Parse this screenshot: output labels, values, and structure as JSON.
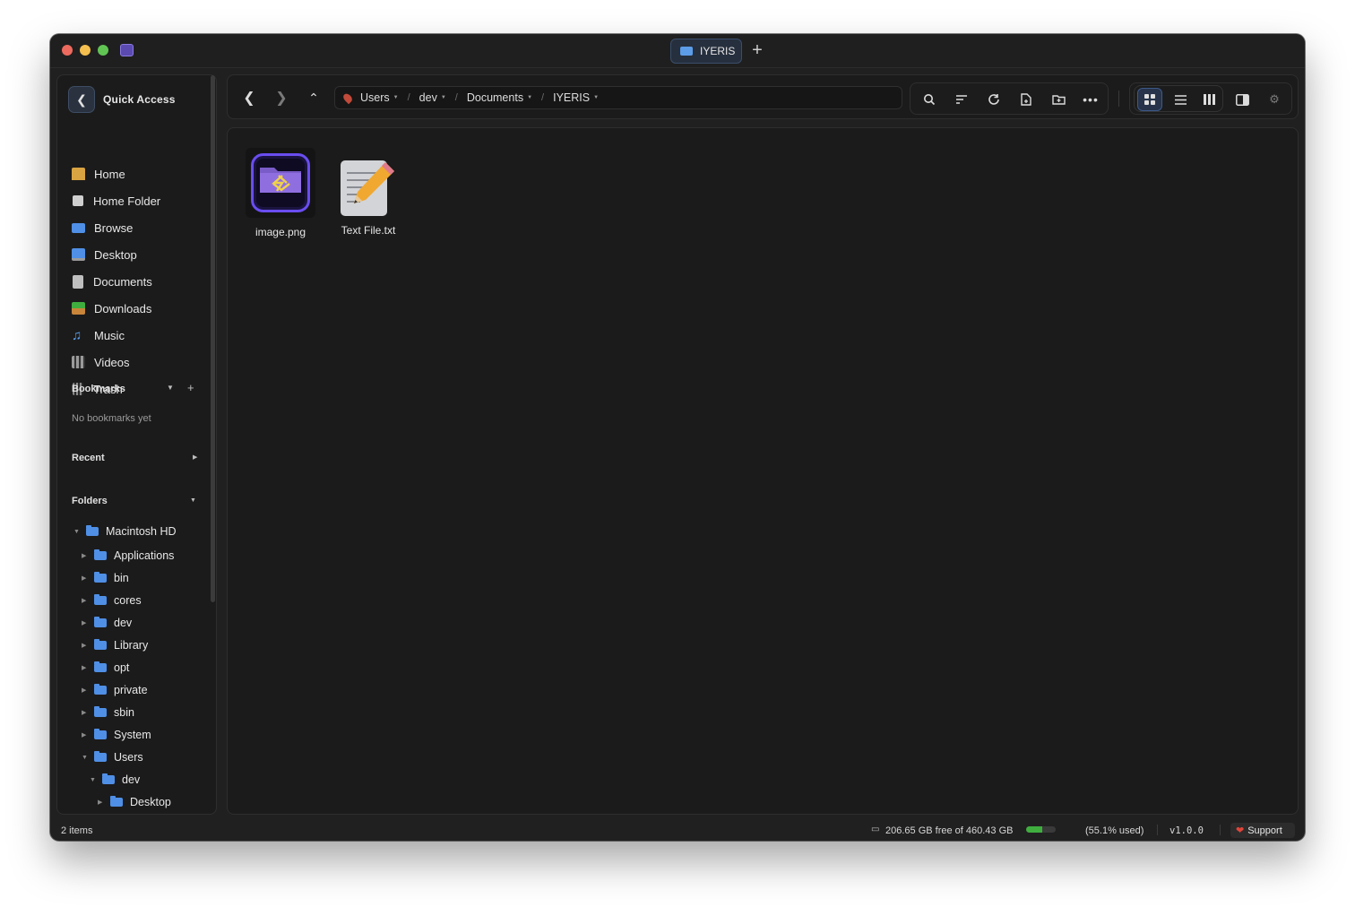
{
  "titlebar": {
    "tab_label": "IYERIS",
    "add_tab_symbol": "+"
  },
  "sidebar": {
    "quick_access_title": "Quick Access",
    "quick_access": [
      {
        "label": "Home",
        "icon": "house-icon",
        "color": "#d9a441"
      },
      {
        "label": "Home Folder",
        "icon": "home-folder-icon",
        "color": "#cccccc"
      },
      {
        "label": "Browse",
        "icon": "folder-icon",
        "color": "#4f8fe6"
      },
      {
        "label": "Desktop",
        "icon": "monitor-icon",
        "color": "#4f8fe6"
      },
      {
        "label": "Documents",
        "icon": "document-icon",
        "color": "#bfbfbf"
      },
      {
        "label": "Downloads",
        "icon": "download-icon",
        "color": "#c9853a"
      },
      {
        "label": "Music",
        "icon": "music-icon",
        "color": "#5aa0ee"
      },
      {
        "label": "Videos",
        "icon": "clapper-icon",
        "color": "#9a9a9a"
      },
      {
        "label": "Trash",
        "icon": "trash-icon",
        "color": "#9a9a9a"
      }
    ],
    "bookmarks_title": "Bookmarks",
    "bookmarks_empty": "No bookmarks yet",
    "recent_title": "Recent",
    "folders_title": "Folders",
    "tree": [
      {
        "label": "Macintosh HD",
        "depth": 0
      },
      {
        "label": "Applications",
        "depth": 1
      },
      {
        "label": "bin",
        "depth": 1
      },
      {
        "label": "cores",
        "depth": 1
      },
      {
        "label": "dev",
        "depth": 1
      },
      {
        "label": "Library",
        "depth": 1
      },
      {
        "label": "opt",
        "depth": 1
      },
      {
        "label": "private",
        "depth": 1
      },
      {
        "label": "sbin",
        "depth": 1
      },
      {
        "label": "System",
        "depth": 1
      },
      {
        "label": "Users",
        "depth": 1
      },
      {
        "label": "dev",
        "depth": 2
      },
      {
        "label": "Desktop",
        "depth": 3
      }
    ]
  },
  "breadcrumb": [
    "Users",
    "dev",
    "Documents",
    "IYERIS"
  ],
  "files": [
    {
      "name": "image.png",
      "icon": "image-app-icon"
    },
    {
      "name": "Text File.txt",
      "icon": "text-edit-icon"
    }
  ],
  "status": {
    "item_count": "2 items",
    "disk_free": "206.65 GB free of 460.43 GB",
    "disk_used_percent": 55.1,
    "disk_used_text": "(55.1% used)",
    "version": "v1.0.0",
    "support_label": "Support"
  },
  "colors": {
    "accent": "#4f8fe6",
    "disk_bar": "#3fae3f",
    "heart": "#e0453a"
  }
}
